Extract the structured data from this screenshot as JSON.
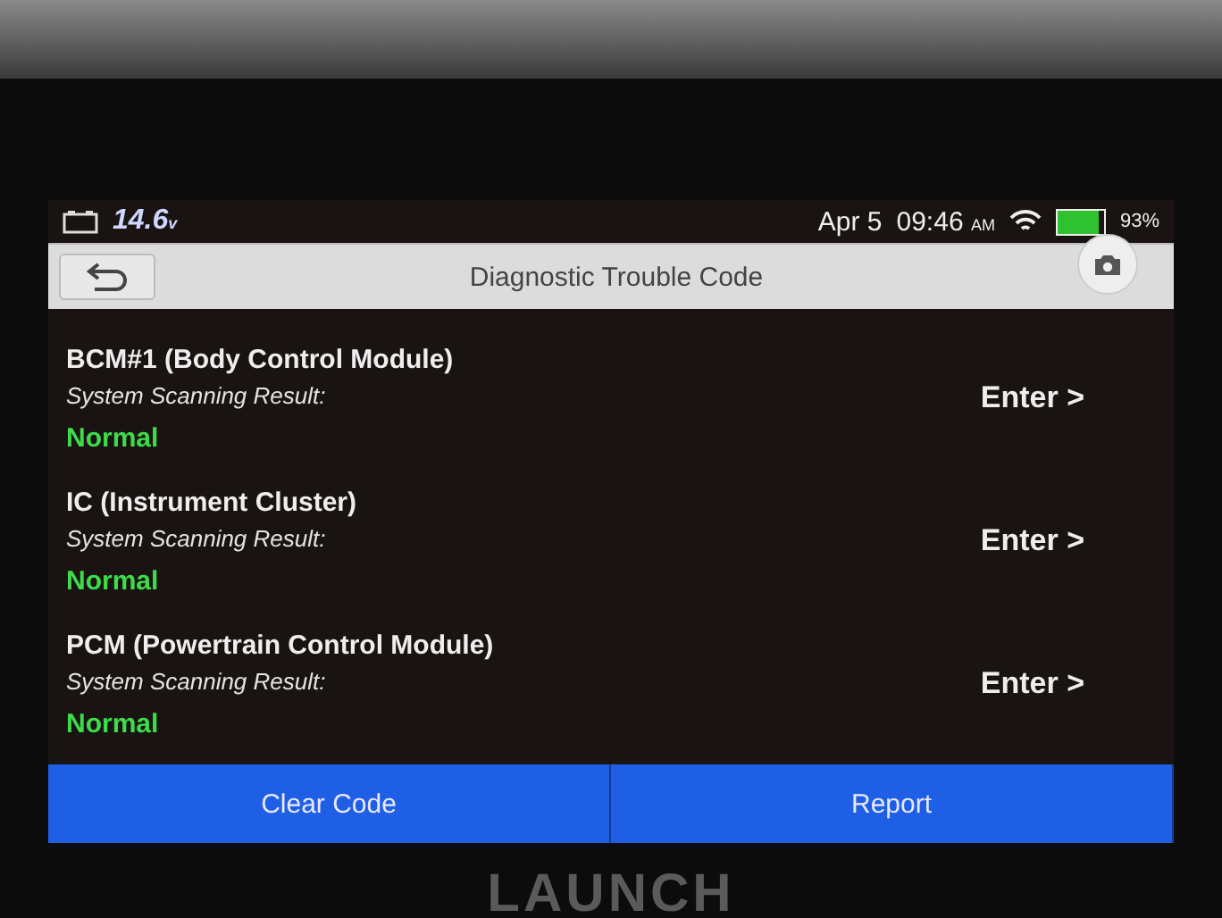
{
  "status_bar": {
    "voltage": "14.6",
    "voltage_unit": "v",
    "date": "Apr 5",
    "time": "09:46",
    "ampm": "AM",
    "battery": "93%"
  },
  "header": {
    "title": "Diagnostic Trouble Code"
  },
  "modules": [
    {
      "name": "BCM#1 (Body Control Module)",
      "result_label": "System Scanning Result:",
      "result": "Normal",
      "action": "Enter >"
    },
    {
      "name": "IC (Instrument Cluster)",
      "result_label": "System Scanning Result:",
      "result": "Normal",
      "action": "Enter >"
    },
    {
      "name": "PCM (Powertrain Control Module)",
      "result_label": "System Scanning Result:",
      "result": "Normal",
      "action": "Enter >"
    }
  ],
  "buttons": [
    "Clear Code",
    "Report"
  ],
  "device_brand": "LAUNCH"
}
